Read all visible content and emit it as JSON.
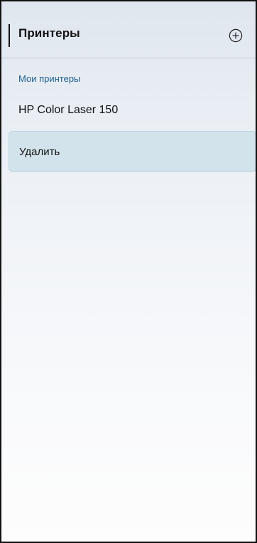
{
  "header": {
    "title": "Принтеры",
    "add_icon": "plus-circle-icon"
  },
  "section": {
    "label": "Мои принтеры"
  },
  "printer": {
    "name": "HP Color Laser 150"
  },
  "context_menu": {
    "items": [
      {
        "label": "Удалить"
      }
    ]
  },
  "colors": {
    "accent": "#1d5e8c",
    "highlight": "#d3e3ec",
    "text": "#111111"
  }
}
